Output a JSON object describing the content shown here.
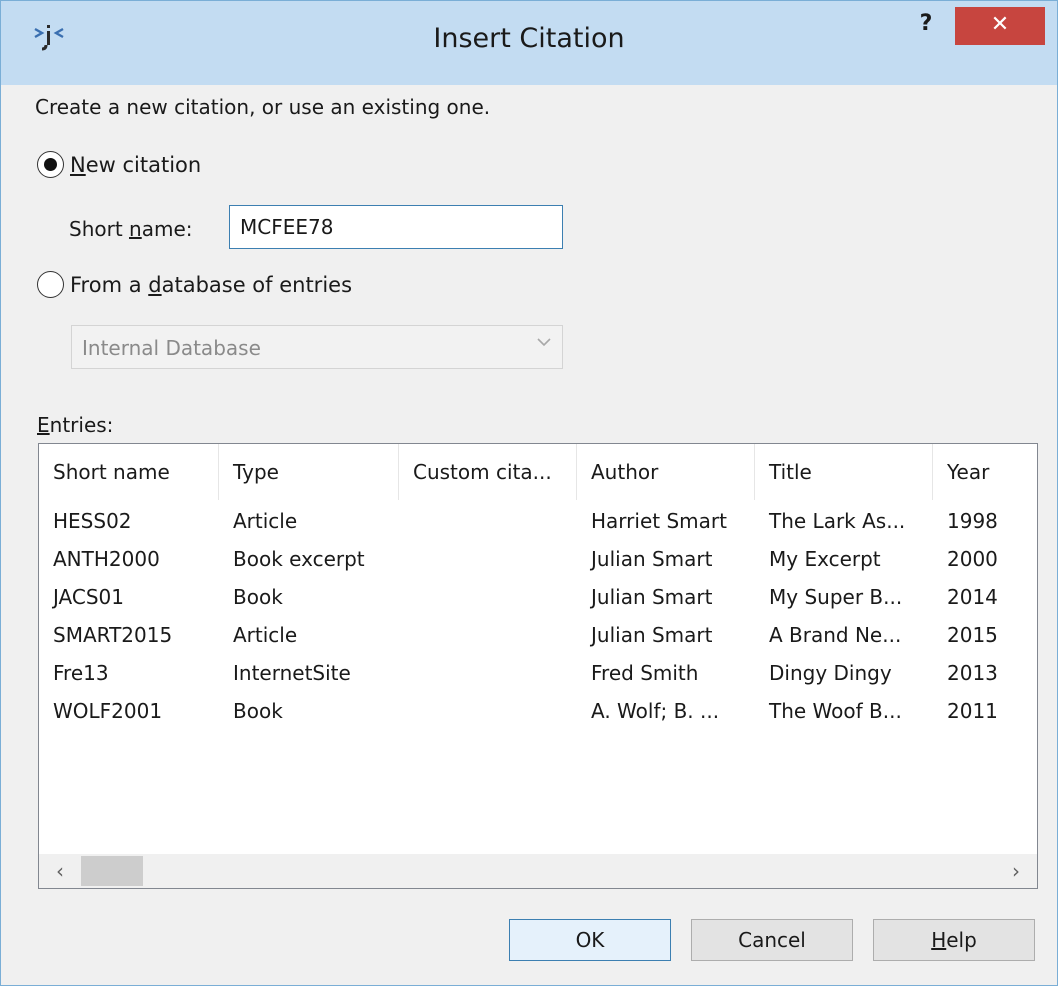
{
  "window": {
    "title": "Insert Citation",
    "help_glyph": "?",
    "close_glyph": "✕",
    "accent_color": "#c7453f",
    "titlebar_color": "#c3dcf2"
  },
  "form": {
    "intro": "Create a new citation, or use an existing one.",
    "new_citation": {
      "label_mnemonic": "N",
      "label_rest": "ew citation",
      "selected": true
    },
    "short_name": {
      "label_pre": "Short ",
      "label_mnemonic": "n",
      "label_post": "ame:",
      "value": "MCFEE78"
    },
    "from_database": {
      "label_pre": "From a ",
      "label_mnemonic": "d",
      "label_post": "atabase of entries",
      "selected": false
    },
    "database_select": {
      "value": "Internal Database",
      "enabled": false
    },
    "entries_label": {
      "label_mnemonic": "E",
      "label_rest": "ntries:"
    }
  },
  "entries": {
    "columns": [
      "Short name",
      "Type",
      "Custom cita...",
      "Author",
      "Title",
      "Year"
    ],
    "rows": [
      [
        "HESS02",
        "Article",
        "",
        "Harriet Smart",
        "The Lark As...",
        "1998"
      ],
      [
        "ANTH2000",
        "Book excerpt",
        "",
        "Julian Smart",
        "My Excerpt",
        "2000"
      ],
      [
        "JACS01",
        "Book",
        "",
        "Julian Smart",
        "My Super B...",
        "2014"
      ],
      [
        "SMART2015",
        "Article",
        "",
        "Julian Smart",
        "A Brand Ne...",
        "2015"
      ],
      [
        "Fre13",
        "InternetSite",
        "",
        "Fred Smith",
        "Dingy Dingy",
        "2013"
      ],
      [
        "WOLF2001",
        "Book",
        "",
        "A. Wolf; B. ...",
        "The Woof B...",
        "2011"
      ]
    ],
    "scroll_left_glyph": "‹",
    "scroll_right_glyph": "›"
  },
  "buttons": {
    "ok": "OK",
    "cancel": "Cancel",
    "help_mnemonic": "H",
    "help_rest": "elp"
  }
}
